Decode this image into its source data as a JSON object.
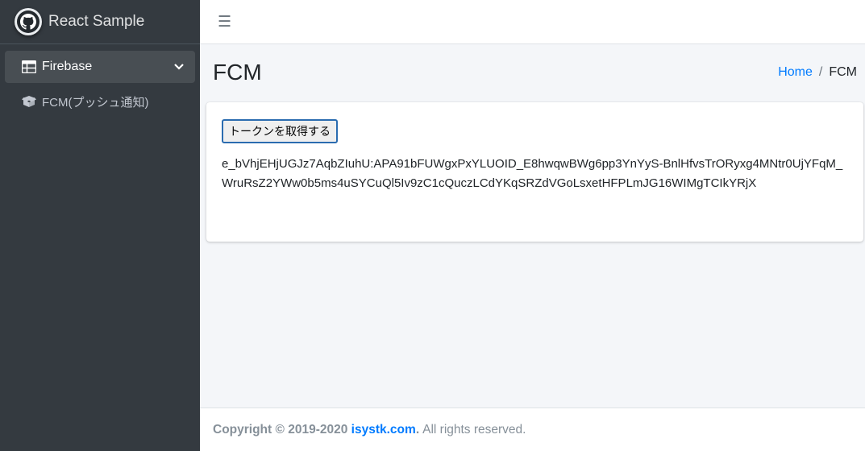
{
  "brand": {
    "name": "React Sample",
    "icon": "github-icon"
  },
  "sidebar": {
    "items": [
      {
        "label": "Firebase",
        "icon": "table-icon",
        "expanded": true
      },
      {
        "label": "FCM(プッシュ通知)",
        "icon": "box-open-icon"
      }
    ]
  },
  "topbar": {
    "menu_icon": "☰"
  },
  "page": {
    "title": "FCM"
  },
  "breadcrumb": {
    "home": "Home",
    "separator": "/",
    "current": "FCM"
  },
  "card": {
    "button_label": "トークンを取得する",
    "token": "e_bVhjEHjUGJz7AqbZIuhU:APA91bFUWgxPxYLUOID_E8hwqwBWg6pp3YnYyS-BnlHfvsTrORyxg4MNtr0UjYFqM_WruRsZ2YWw0b5ms4uSYCuQl5Iv9zC1cQuczLCdYKqSRZdVGoLsxetHFPLmJG16WIMgTCIkYRjX"
  },
  "footer": {
    "copyright": "Copyright © 2019-2020",
    "link": "isystk.com",
    "suffix": ".",
    "rights": "All rights reserved."
  },
  "colors": {
    "sidebar_bg": "#343a40",
    "link": "#007bff",
    "content_bg": "#f4f6f9"
  }
}
